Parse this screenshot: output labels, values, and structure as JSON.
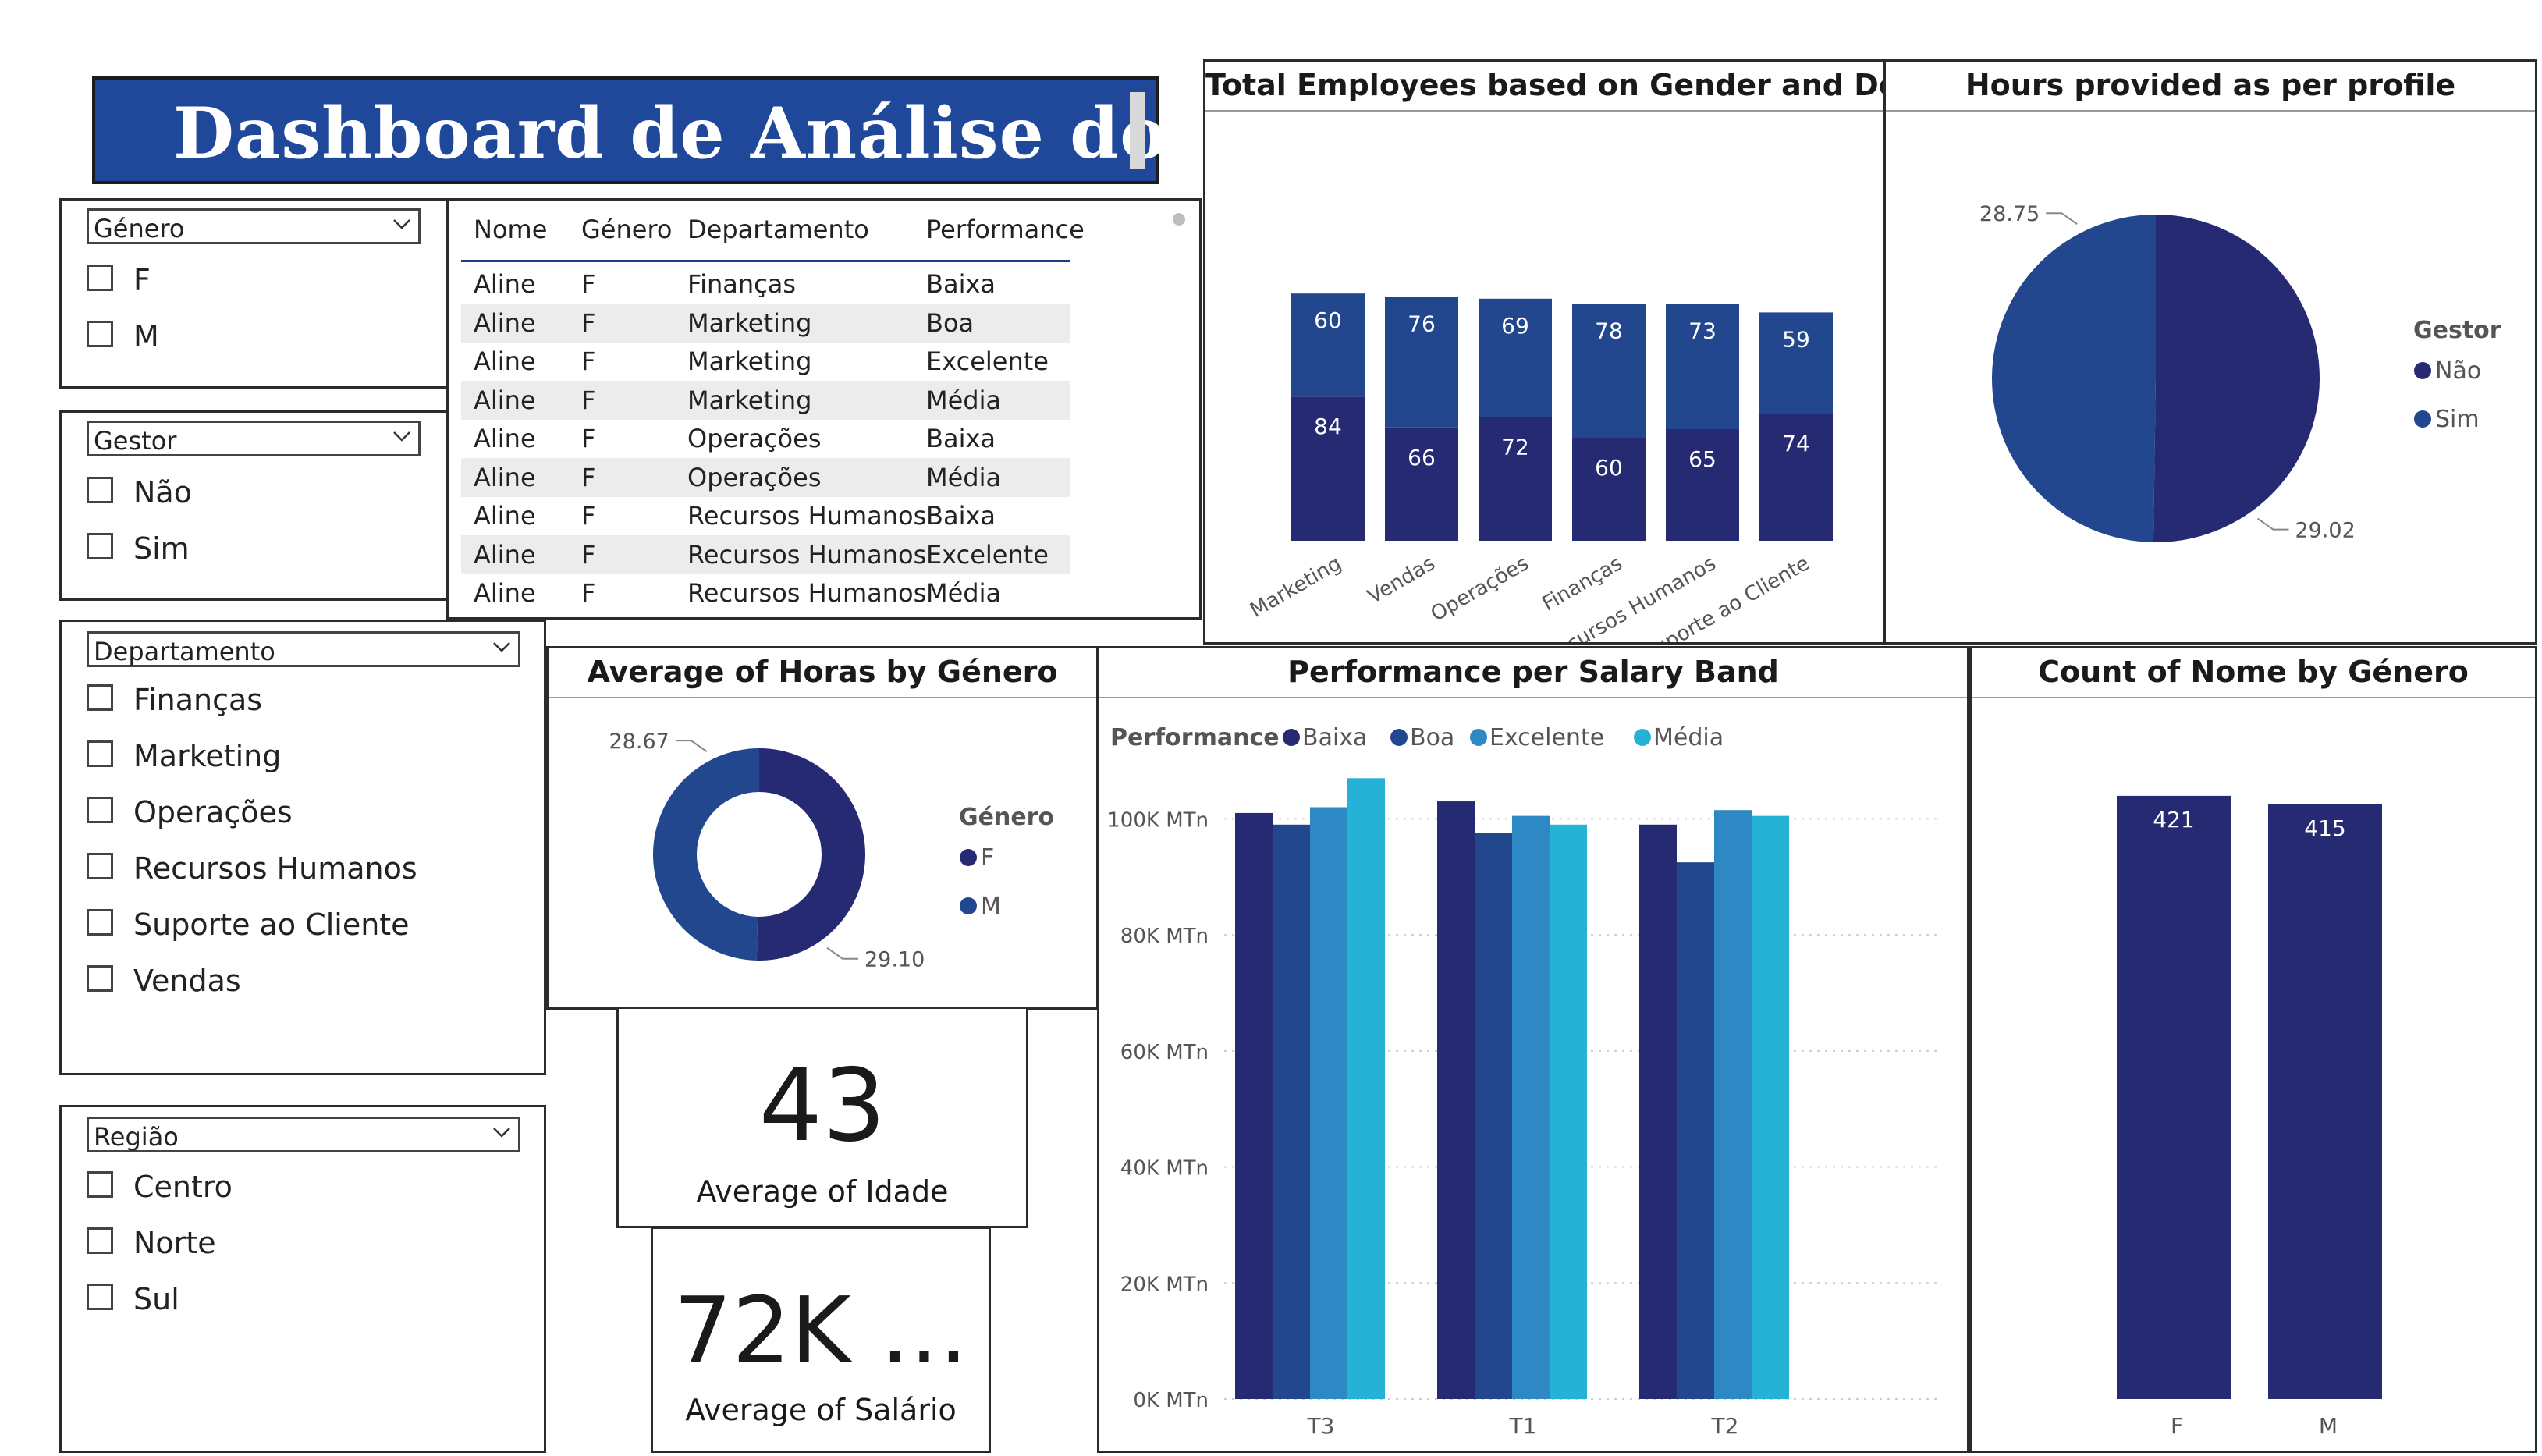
{
  "title": "Dashboard de Análise do RH",
  "slicers": {
    "genero": {
      "label": "Género",
      "options": [
        "F",
        "M"
      ]
    },
    "gestor": {
      "label": "Gestor",
      "options": [
        "Não",
        "Sim"
      ]
    },
    "departamento": {
      "label": "Departamento",
      "options": [
        "Finanças",
        "Marketing",
        "Operações",
        "Recursos Humanos",
        "Suporte ao Cliente",
        "Vendas"
      ]
    },
    "regiao": {
      "label": "Região",
      "options": [
        "Centro",
        "Norte",
        "Sul"
      ]
    }
  },
  "table": {
    "headers": [
      "Nome",
      "Género",
      "Departamento",
      "Performance"
    ],
    "rows": [
      [
        "Aline",
        "F",
        "Finanças",
        "Baixa"
      ],
      [
        "Aline",
        "F",
        "Marketing",
        "Boa"
      ],
      [
        "Aline",
        "F",
        "Marketing",
        "Excelente"
      ],
      [
        "Aline",
        "F",
        "Marketing",
        "Média"
      ],
      [
        "Aline",
        "F",
        "Operações",
        "Baixa"
      ],
      [
        "Aline",
        "F",
        "Operações",
        "Média"
      ],
      [
        "Aline",
        "F",
        "Recursos Humanos",
        "Baixa"
      ],
      [
        "Aline",
        "F",
        "Recursos Humanos",
        "Excelente"
      ],
      [
        "Aline",
        "F",
        "Recursos Humanos",
        "Média"
      ]
    ]
  },
  "cards": {
    "idade": {
      "value": "43",
      "label": "Average of Idade"
    },
    "salario": {
      "value": "72K ...",
      "label": "Average of Salário"
    }
  },
  "colors": {
    "banner": "#20489a",
    "dark_navy": "#252a73",
    "mid_blue": "#22478f",
    "sky_blue": "#2e88c4",
    "cyan": "#26b1d6"
  },
  "chart_data": [
    {
      "type": "bar",
      "title": "Total Employees based on Gender and Deptt.",
      "stacked": true,
      "categories": [
        "Marketing",
        "Vendas",
        "Operações",
        "Finanças",
        "Recursos Humanos",
        "Suporte ao Cliente"
      ],
      "series": [
        {
          "values": [
            84,
            66,
            72,
            60,
            65,
            74
          ],
          "color": "#252a73"
        },
        {
          "values": [
            60,
            76,
            69,
            78,
            73,
            59
          ],
          "color": "#22478f"
        }
      ]
    },
    {
      "type": "pie",
      "title": "Hours provided as per profile",
      "legend_title": "Gestor",
      "slices": [
        {
          "name": "Não",
          "value": 29.02,
          "color": "#252a73"
        },
        {
          "name": "Sim",
          "value": 28.75,
          "color": "#22478f"
        }
      ]
    },
    {
      "type": "pie",
      "donut": true,
      "title": "Average of Horas by Género",
      "legend_title": "Género",
      "slices": [
        {
          "name": "F",
          "value": 29.1,
          "color": "#252a73"
        },
        {
          "name": "M",
          "value": 28.67,
          "color": "#22478f"
        }
      ]
    },
    {
      "type": "bar",
      "title": "Performance per Salary Band",
      "legend_title": "Performance",
      "categories": [
        "T3",
        "T1",
        "T2"
      ],
      "series": [
        {
          "name": "Baixa",
          "values": [
            101000,
            103000,
            99000
          ],
          "color": "#252a73"
        },
        {
          "name": "Boa",
          "values": [
            99000,
            97500,
            92500
          ],
          "color": "#22478f"
        },
        {
          "name": "Excelente",
          "values": [
            102000,
            100500,
            101500
          ],
          "color": "#2e88c4"
        },
        {
          "name": "Média",
          "values": [
            107000,
            99000,
            100500
          ],
          "color": "#26b1d6"
        }
      ],
      "ylim": [
        0,
        110000
      ],
      "yticks": [
        "0K MTn",
        "20K MTn",
        "40K MTn",
        "60K MTn",
        "80K MTn",
        "100K MTn"
      ],
      "ytick_values": [
        0,
        20000,
        40000,
        60000,
        80000,
        100000
      ],
      "legend_position": "top-left",
      "grid": true
    },
    {
      "type": "bar",
      "title": "Count of Nome by Género",
      "categories": [
        "F",
        "M"
      ],
      "values": [
        421,
        415
      ],
      "color": "#252a73"
    }
  ]
}
